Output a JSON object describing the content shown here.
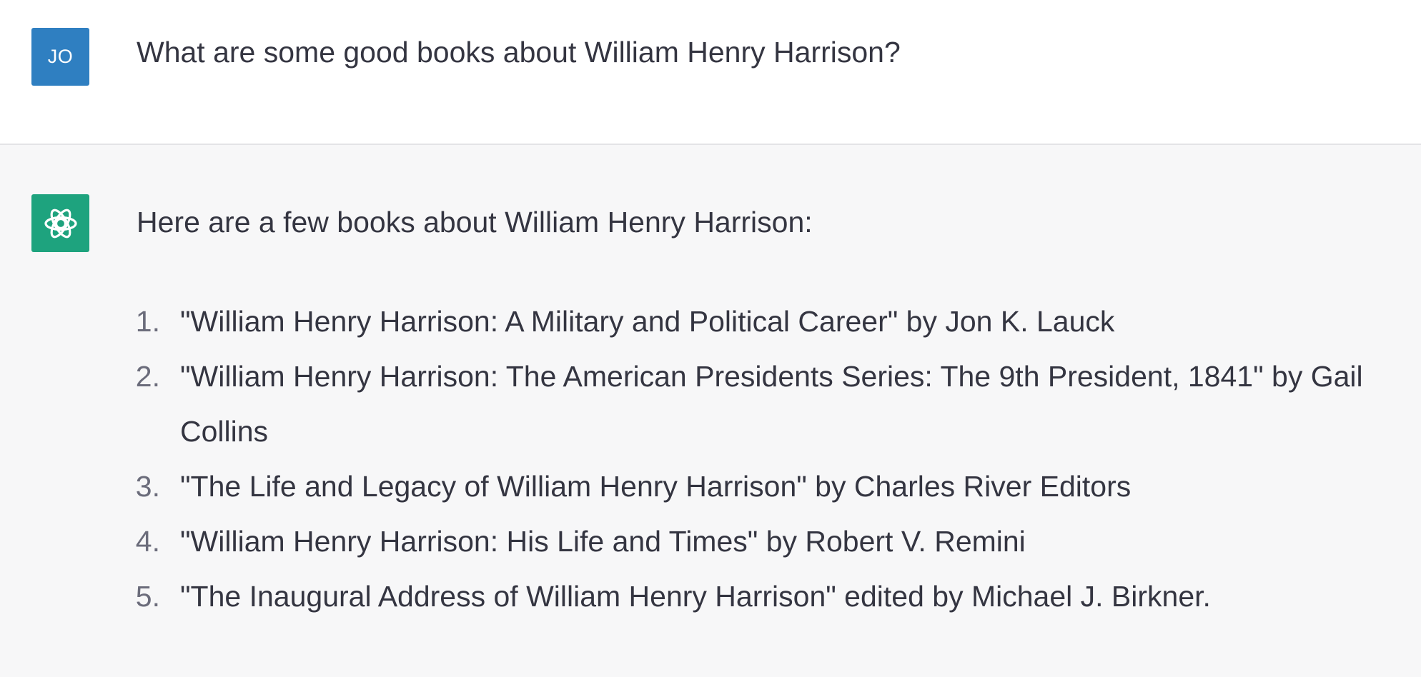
{
  "user_message": {
    "avatar_initials": "JO",
    "text": "What are some good books about William Henry Harrison?"
  },
  "assistant_message": {
    "avatar_icon": "openai-logo-icon",
    "intro": "Here are a few books about William Henry Harrison:",
    "books": [
      {
        "number": "1.",
        "text": "\"William Henry Harrison: A Military and Political Career\" by Jon K. Lauck"
      },
      {
        "number": "2.",
        "text": "\"William Henry Harrison: The American Presidents Series: The 9th President, 1841\" by Gail Collins"
      },
      {
        "number": "3.",
        "text": "\"The Life and Legacy of William Henry Harrison\" by Charles River Editors"
      },
      {
        "number": "4.",
        "text": "\"William Henry Harrison: His Life and Times\" by Robert V. Remini"
      },
      {
        "number": "5.",
        "text": "\"The Inaugural Address of William Henry Harrison\" edited by Michael J. Birkner."
      }
    ]
  },
  "colors": {
    "user_avatar_bg": "#2f7fc1",
    "bot_avatar_bg": "#1ea37e",
    "user_row_bg": "#ffffff",
    "assistant_row_bg": "#f7f7f8",
    "text": "#343541"
  }
}
